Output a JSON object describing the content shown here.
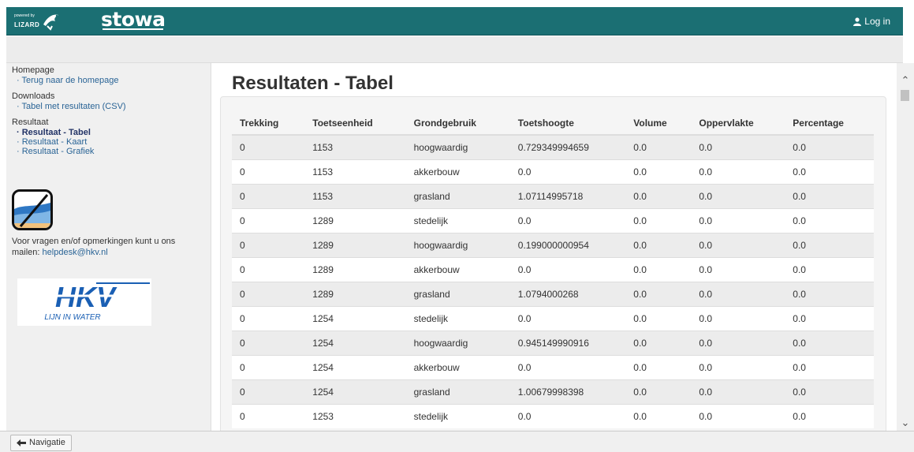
{
  "header": {
    "lizard_small": "powered by",
    "lizard_word": "LIZARD",
    "brand": "stowa",
    "login_label": "Log in",
    "login_icon": "user-icon"
  },
  "sidebar": {
    "groups": [
      {
        "heading": "Homepage",
        "items": [
          "Terug naar de homepage"
        ]
      },
      {
        "heading": "Downloads",
        "items": [
          "Tabel met resultaten (CSV)"
        ]
      },
      {
        "heading": "Resultaat",
        "items": [
          "Resultaat - Tabel",
          "Resultaat - Kaart",
          "Resultaat - Grafiek"
        ]
      }
    ],
    "active_item": "Resultaat - Tabel",
    "contact_text": "Voor vragen en/of opmerkingen kunt u ons mailen: ",
    "contact_email": "helpdesk@hkv.nl",
    "hkv_logo": "HKV",
    "hkv_tagline": "LIJN IN WATER"
  },
  "main": {
    "title": "Resultaten - Tabel",
    "columns": [
      "Trekking",
      "Toetseenheid",
      "Grondgebruik",
      "Toetshoogte",
      "Volume",
      "Oppervlakte",
      "Percentage"
    ],
    "rows": [
      [
        "0",
        "1153",
        "hoogwaardig",
        "0.729349994659",
        "0.0",
        "0.0",
        "0.0"
      ],
      [
        "0",
        "1153",
        "akkerbouw",
        "0.0",
        "0.0",
        "0.0",
        "0.0"
      ],
      [
        "0",
        "1153",
        "grasland",
        "1.07114995718",
        "0.0",
        "0.0",
        "0.0"
      ],
      [
        "0",
        "1289",
        "stedelijk",
        "0.0",
        "0.0",
        "0.0",
        "0.0"
      ],
      [
        "0",
        "1289",
        "hoogwaardig",
        "0.199000000954",
        "0.0",
        "0.0",
        "0.0"
      ],
      [
        "0",
        "1289",
        "akkerbouw",
        "0.0",
        "0.0",
        "0.0",
        "0.0"
      ],
      [
        "0",
        "1289",
        "grasland",
        "1.0794000268",
        "0.0",
        "0.0",
        "0.0"
      ],
      [
        "0",
        "1254",
        "stedelijk",
        "0.0",
        "0.0",
        "0.0",
        "0.0"
      ],
      [
        "0",
        "1254",
        "hoogwaardig",
        "0.945149990916",
        "0.0",
        "0.0",
        "0.0"
      ],
      [
        "0",
        "1254",
        "akkerbouw",
        "0.0",
        "0.0",
        "0.0",
        "0.0"
      ],
      [
        "0",
        "1254",
        "grasland",
        "1.00679998398",
        "0.0",
        "0.0",
        "0.0"
      ],
      [
        "0",
        "1253",
        "stedelijk",
        "0.0",
        "0.0",
        "0.0",
        "0.0"
      ]
    ]
  },
  "footer": {
    "nav_button_label": "Navigatie",
    "nav_button_icon": "arrow-left-icon"
  },
  "colors": {
    "header_bg": "#1b6f73",
    "link": "#2a6496",
    "hkv_blue": "#1a5fb4"
  }
}
